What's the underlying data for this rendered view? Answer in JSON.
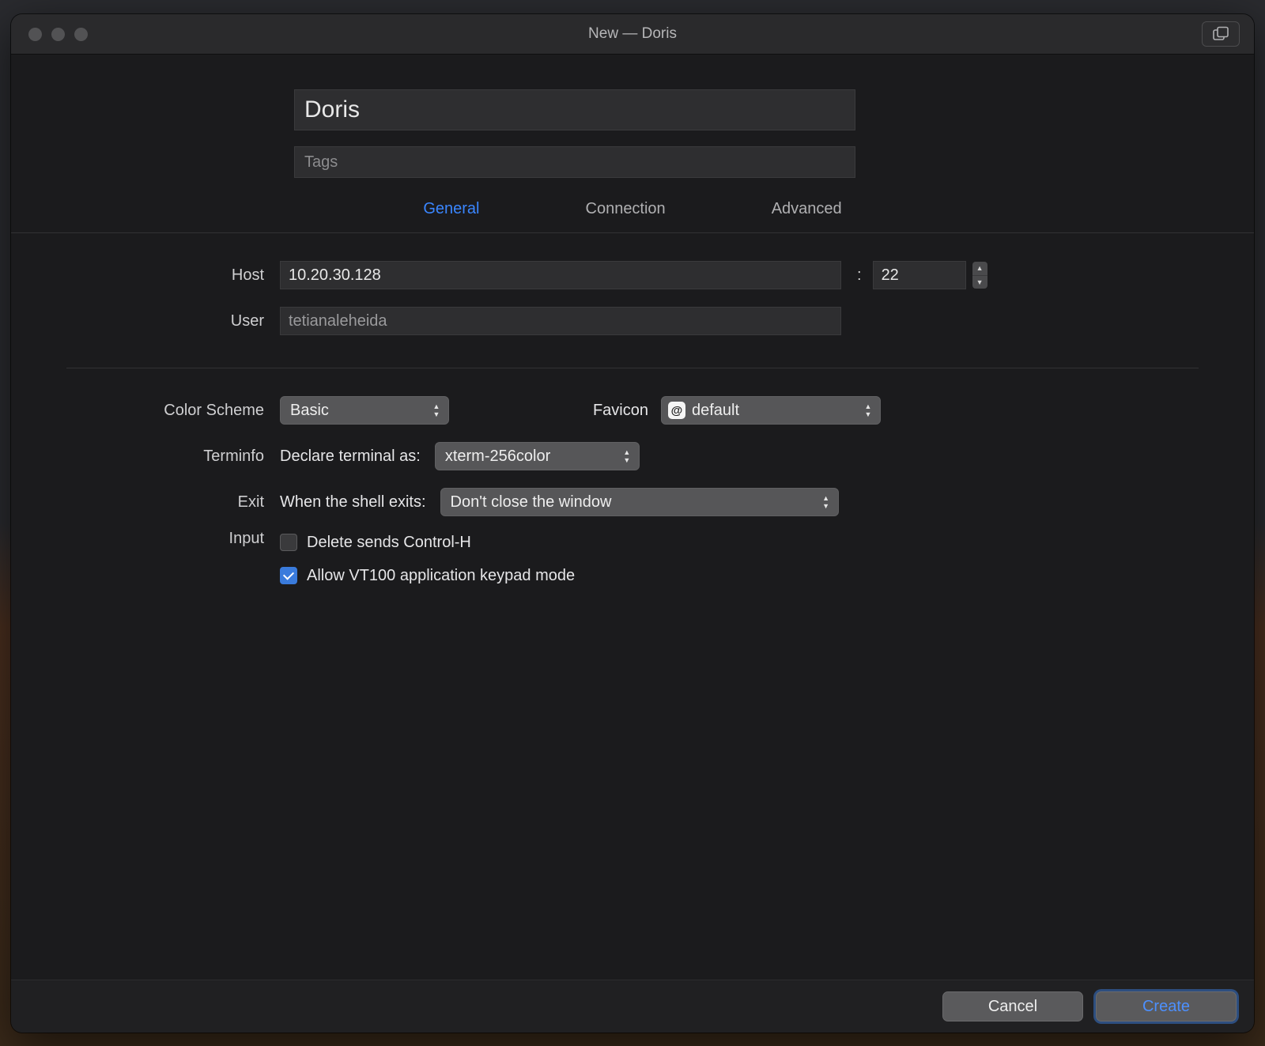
{
  "window": {
    "title": "New — Doris"
  },
  "header": {
    "name_value": "Doris",
    "tags_placeholder": "Tags"
  },
  "tabs": {
    "general": "General",
    "connection": "Connection",
    "advanced": "Advanced",
    "active": "general"
  },
  "connection": {
    "host_label": "Host",
    "host_value": "10.20.30.128",
    "port_value": "22",
    "user_label": "User",
    "user_value": "tetianaleheida"
  },
  "settings": {
    "color_scheme_label": "Color Scheme",
    "color_scheme_value": "Basic",
    "favicon_label": "Favicon",
    "favicon_badge": "@",
    "favicon_value": "default",
    "terminfo_label": "Terminfo",
    "terminfo_text": "Declare terminal as:",
    "terminfo_value": "xterm-256color",
    "exit_label": "Exit",
    "exit_text": "When the shell exits:",
    "exit_value": "Don't close the window",
    "input_label": "Input",
    "delete_ctrl_h_label": "Delete sends Control-H",
    "delete_ctrl_h_checked": false,
    "vt100_label": "Allow VT100 application keypad mode",
    "vt100_checked": true
  },
  "footer": {
    "cancel": "Cancel",
    "create": "Create"
  }
}
